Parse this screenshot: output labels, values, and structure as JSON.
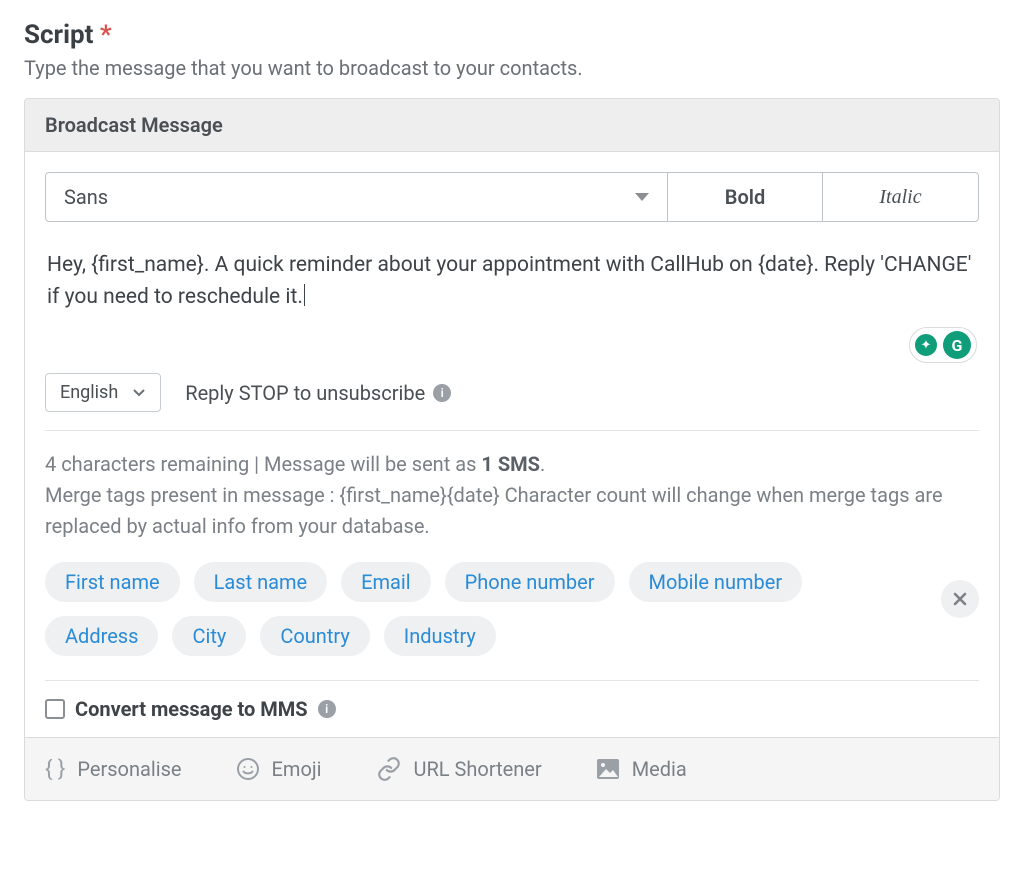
{
  "heading": {
    "label": "Script",
    "required_marker": "*"
  },
  "subheading": "Type the message that you want to broadcast to your contacts.",
  "panel": {
    "title": "Broadcast Message",
    "toolbar": {
      "font": "Sans",
      "bold": "Bold",
      "italic": "Italic"
    },
    "editor_text": "Hey, {first_name}. A quick reminder about your appointment with CallHub on {date}. Reply 'CHANGE' if you need to reschedule it.",
    "language": "English",
    "unsubscribe_hint": "Reply STOP to unsubscribe",
    "info": {
      "chars_prefix": "4 characters remaining",
      "separator": " | ",
      "sent_as_prefix": "Message will be sent as ",
      "sent_as_value": "1 SMS",
      "sent_as_suffix": ".",
      "merge_line": "Merge tags present in message : {first_name}{date} Character count will change when merge tags are replaced by actual info from your database."
    },
    "tags": [
      "First name",
      "Last name",
      "Email",
      "Phone number",
      "Mobile number",
      "Address",
      "City",
      "Country",
      "Industry"
    ],
    "mms": {
      "label": "Convert message to MMS"
    },
    "footer": {
      "personalise": "Personalise",
      "emoji": "Emoji",
      "url_shortener": "URL Shortener",
      "media": "Media"
    }
  }
}
